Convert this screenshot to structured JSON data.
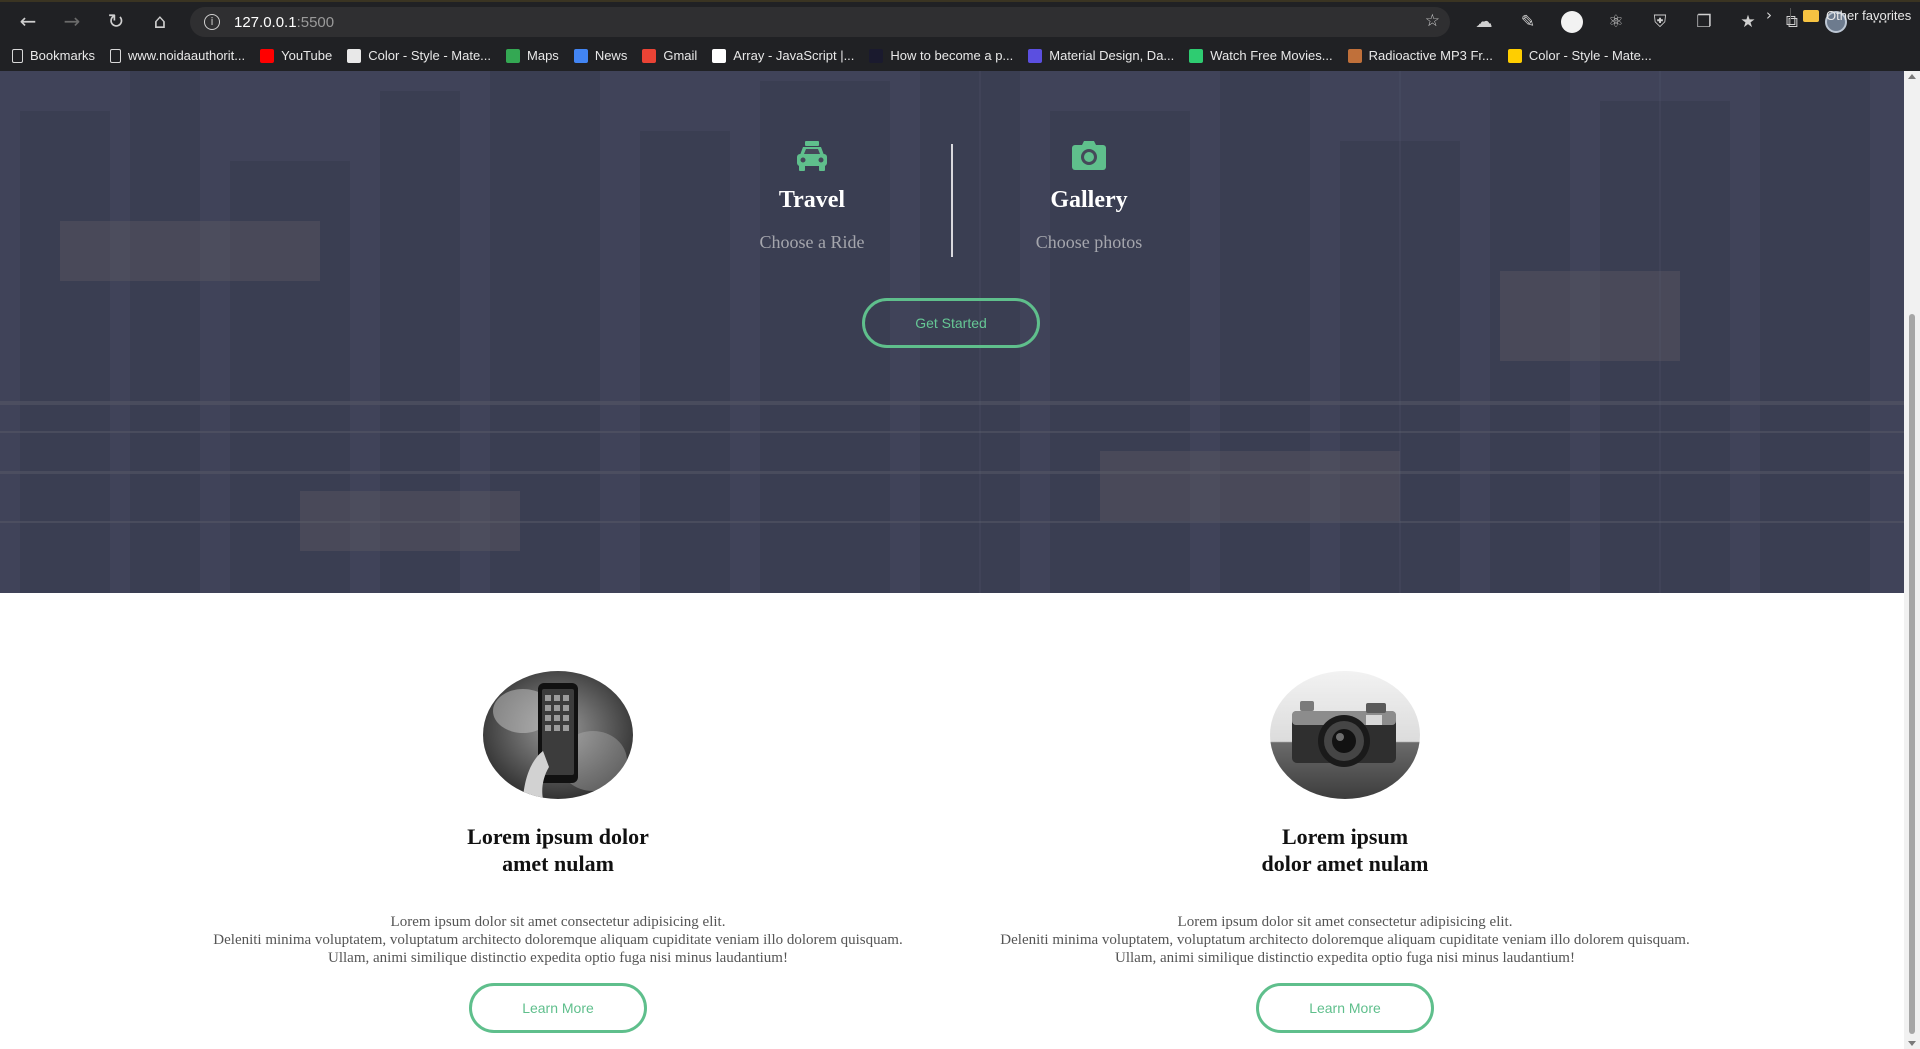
{
  "browser": {
    "url_host": "127.0.0.1",
    "url_port": ":5500",
    "nav": {
      "back_icon": "back-arrow-icon",
      "forward_icon": "forward-arrow-icon",
      "reload_icon": "reload-icon",
      "home_icon": "home-icon"
    },
    "bookmarks": [
      {
        "label": "Bookmarks",
        "icon": "page-icon",
        "color": "#d8d8d8"
      },
      {
        "label": "www.noidaauthorit...",
        "icon": "page-icon",
        "color": "#d8d8d8"
      },
      {
        "label": "YouTube",
        "icon": "youtube-icon",
        "color": "#ff0000"
      },
      {
        "label": "Color - Style - Mate...",
        "icon": "material-icon",
        "color": "#e8e8e8"
      },
      {
        "label": "Maps",
        "icon": "maps-icon",
        "color": "#34a853"
      },
      {
        "label": "News",
        "icon": "news-icon",
        "color": "#4285f4"
      },
      {
        "label": "Gmail",
        "icon": "gmail-icon",
        "color": "#ea4335"
      },
      {
        "label": "Array - JavaScript |...",
        "icon": "mdn-icon",
        "color": "#ffffff"
      },
      {
        "label": "How to become a p...",
        "icon": "how-to-icon",
        "color": "#1a1a2e"
      },
      {
        "label": "Material Design, Da...",
        "icon": "vp-icon",
        "color": "#5b4fe0"
      },
      {
        "label": "Watch Free Movies...",
        "icon": "play-icon",
        "color": "#2ecc71"
      },
      {
        "label": "Radioactive MP3 Fr...",
        "icon": "paw-icon",
        "color": "#c0703a"
      },
      {
        "label": "Color - Style - Mate...",
        "icon": "flag-icon",
        "color": "#ffce00"
      }
    ],
    "other_favorites": "Other favorites"
  },
  "hero": {
    "features": [
      {
        "icon": "taxi-icon",
        "title": "Travel",
        "subtitle": "Choose a Ride"
      },
      {
        "icon": "camera-icon",
        "title": "Gallery",
        "subtitle": "Choose photos"
      }
    ],
    "cta_label": "Get Started",
    "accent_color": "#5fbf8c"
  },
  "cards": [
    {
      "image": "smartphone-photo",
      "title_line1": "Lorem ipsum dolor",
      "title_line2": "amet nulam",
      "desc_line1": "Lorem ipsum dolor sit amet consectetur adipisicing elit.",
      "desc_line2": "Deleniti minima voluptatem, voluptatum architecto doloremque aliquam cupiditate veniam illo dolorem quisquam.",
      "desc_line3": "Ullam, animi similique distinctio expedita optio fuga nisi minus laudantium!",
      "button_label": "Learn More"
    },
    {
      "image": "camera-photo",
      "title_line1": "Lorem ipsum",
      "title_line2": "dolor amet nulam",
      "desc_line1": "Lorem ipsum dolor sit amet consectetur adipisicing elit.",
      "desc_line2": "Deleniti minima voluptatem, voluptatum architecto doloremque aliquam cupiditate veniam illo dolorem quisquam.",
      "desc_line3": "Ullam, animi similique distinctio expedita optio fuga nisi minus laudantium!",
      "button_label": "Learn More"
    }
  ]
}
